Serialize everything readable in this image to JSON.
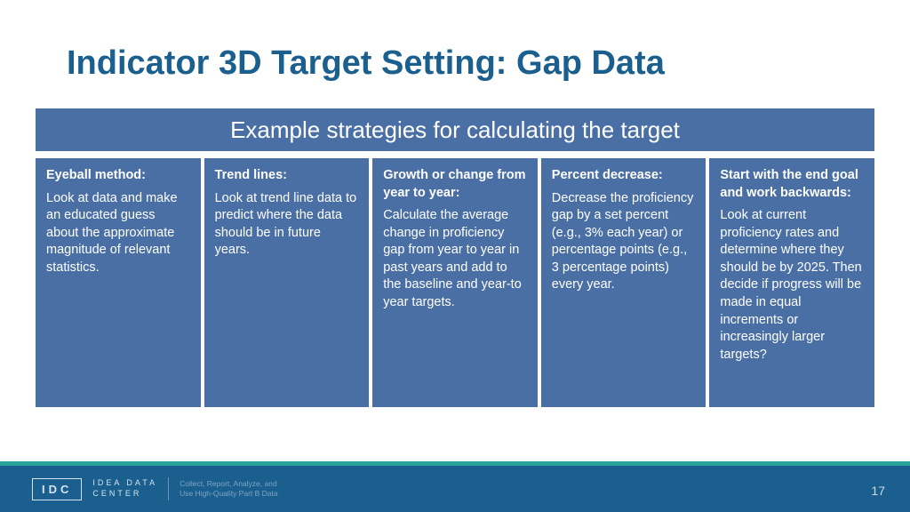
{
  "title": "Indicator 3D Target Setting: Gap Data",
  "subtitle": "Example strategies for calculating the target",
  "cards": [
    {
      "title": "Eyeball method:",
      "body": "Look at data and make an educated guess about the approximate magnitude of relevant statistics."
    },
    {
      "title": "Trend lines:",
      "body": "Look at trend line data to predict where the data should be in future years."
    },
    {
      "title": "Growth or change from year to year:",
      "body": "Calculate the average change in proficiency gap from year to year in past years and add to the baseline and year-to year targets."
    },
    {
      "title": "Percent decrease:",
      "body": "Decrease the proficiency gap by a set percent (e.g., 3% each year) or percentage points (e.g., 3 percentage points) every year."
    },
    {
      "title": "Start with the end goal and work backwards:",
      "body": "Look at current proficiency rates and determine where they should be by 2025. Then decide if progress will be made in equal increments or increasingly larger targets?"
    }
  ],
  "footer": {
    "logo_box": "IDC",
    "logo_label_1": "IDEA DATA",
    "logo_label_2": "CENTER",
    "tagline_1": "Collect, Report, Analyze, and",
    "tagline_2": "Use High-Quality Part B Data"
  },
  "page_number": "17"
}
